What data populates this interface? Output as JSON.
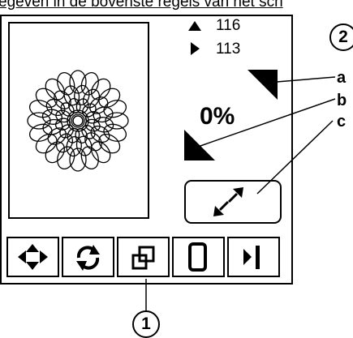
{
  "caption": "egeven in de bovenste regels van het sch",
  "dimensions": {
    "width_value": "116",
    "height_value": "113",
    "width_icon": "triangle-up-icon",
    "height_icon": "triangle-right-icon"
  },
  "scale": {
    "percent": "0%"
  },
  "restore_button": {
    "icon": "resize-arrows-icon"
  },
  "tabs": [
    {
      "name": "move-tab",
      "icon": "move-arrows-icon"
    },
    {
      "name": "rotate-tab",
      "icon": "rotate-icon"
    },
    {
      "name": "resize-tab",
      "icon": "resize-icon"
    },
    {
      "name": "hoop-tab",
      "icon": "hoop-icon"
    },
    {
      "name": "next-tab",
      "icon": "play-bar-icon"
    }
  ],
  "callouts": {
    "a": "a",
    "b": "b",
    "c": "c",
    "one": "1",
    "two": "2"
  }
}
